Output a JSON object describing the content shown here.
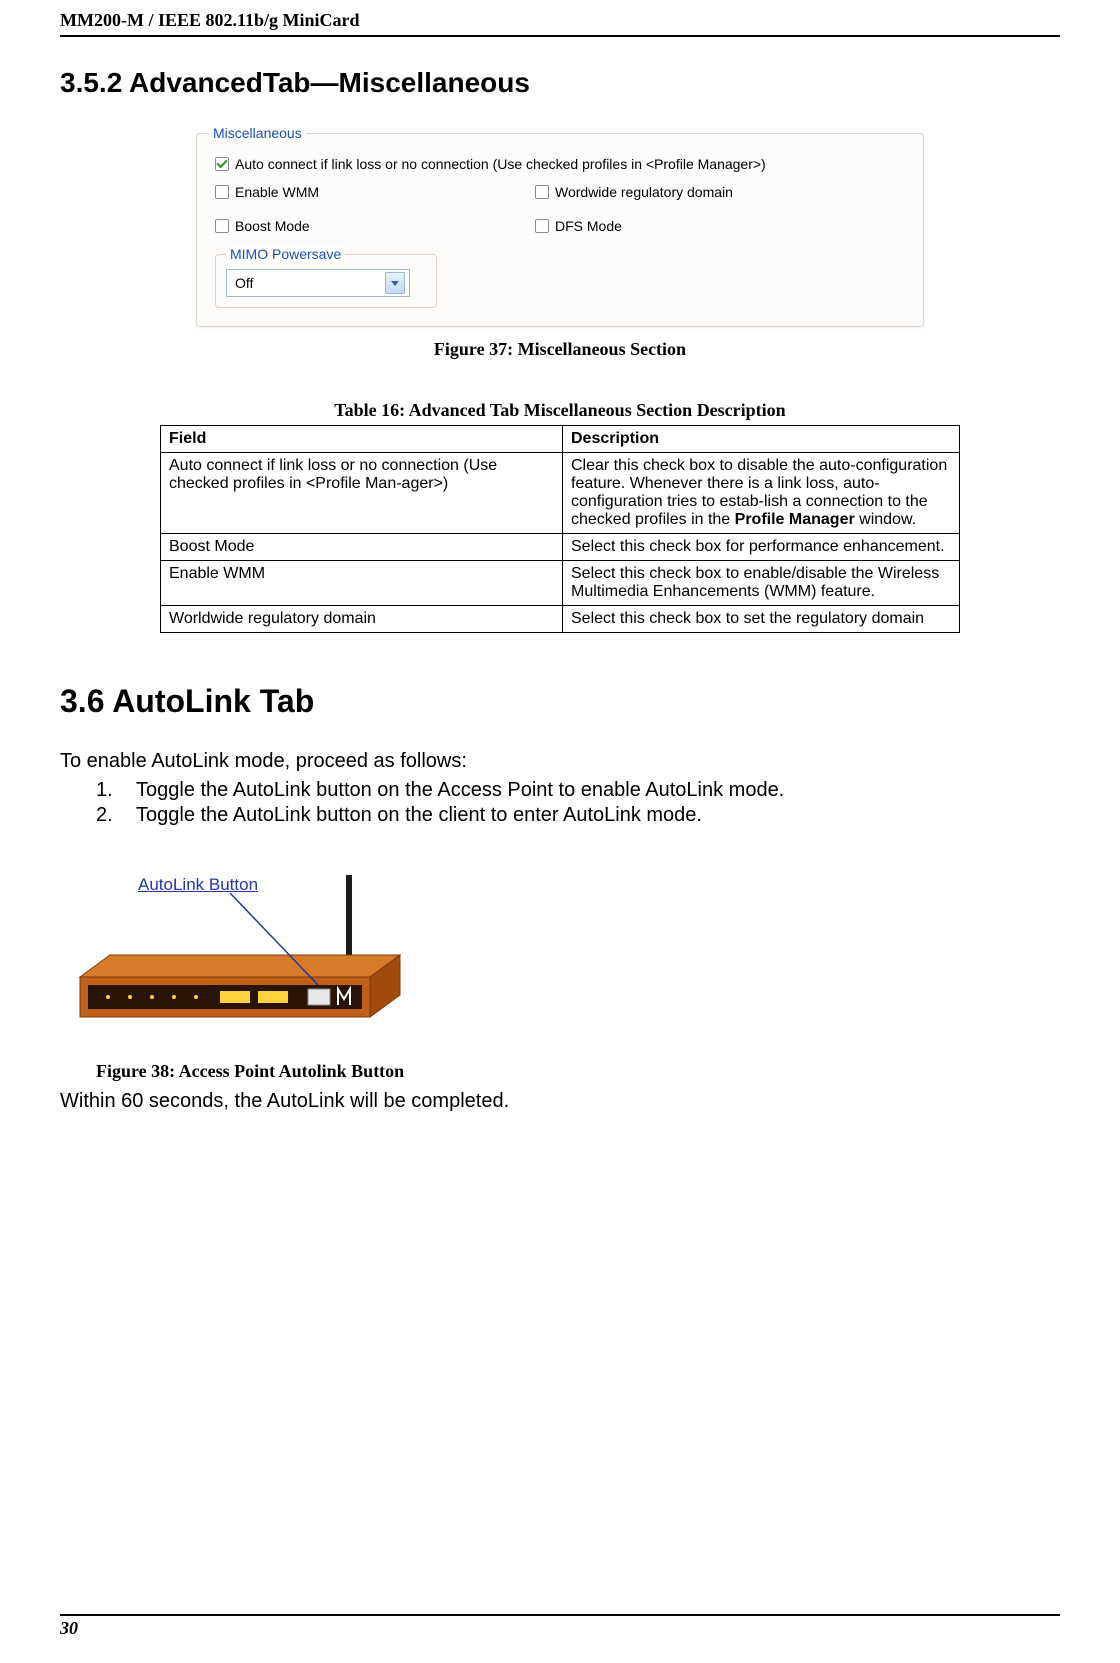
{
  "header": "MM200-M / IEEE 802.11b/g MiniCard",
  "section_3_5_2_title": "3.5.2 AdvancedTab—Miscellaneous",
  "ui_panel": {
    "group_label": "Miscellaneous",
    "opt_autoconnect": "Auto connect if link loss or no connection (Use checked profiles in <Profile Manager>)",
    "opt_enable_wmm": "Enable WMM",
    "opt_reg_domain": "Wordwide regulatory domain",
    "opt_boost": "Boost Mode",
    "opt_dfs": "DFS Mode",
    "mimo_label": "MIMO Powersave",
    "mimo_value": "Off"
  },
  "figure37_caption": "Figure 37: Miscellaneous Section",
  "table16_caption": "Table 16: Advanced Tab Miscellaneous Section Description",
  "table16": {
    "h_field": "Field",
    "h_desc": "Description",
    "rows": [
      {
        "field": "Auto connect if link loss or no connection (Use checked profiles in <Profile Man-ager>)",
        "desc": "Clear this check box to disable the auto-configuration feature. Whenever there is a link loss, auto-configuration tries to estab-lish a connection to the checked profiles in the Profile Manager window."
      },
      {
        "field": "Boost Mode",
        "desc": "Select this check box for performance enhancement."
      },
      {
        "field": "Enable WMM",
        "desc": "Select this check box to enable/disable the Wireless Multimedia Enhancements (WMM) feature."
      },
      {
        "field": "Worldwide regulatory domain",
        "desc": "Select this check box to set the regulatory domain"
      }
    ]
  },
  "section_3_6_title": "3.6 AutoLink Tab",
  "autolink_intro": "To enable AutoLink mode, proceed as follows:",
  "autolink_step1_num": "1.",
  "autolink_step1": "Toggle the AutoLink button on the Access Point to enable AutoLink mode.",
  "autolink_step2_num": "2.",
  "autolink_step2": "Toggle the AutoLink button on the client to enter AutoLink mode.",
  "autolink_button_label": "AutoLink Button",
  "figure38_caption": "Figure 38: Access Point Autolink Button",
  "autolink_done": "Within 60 seconds, the AutoLink will be completed.",
  "page_number": "30"
}
